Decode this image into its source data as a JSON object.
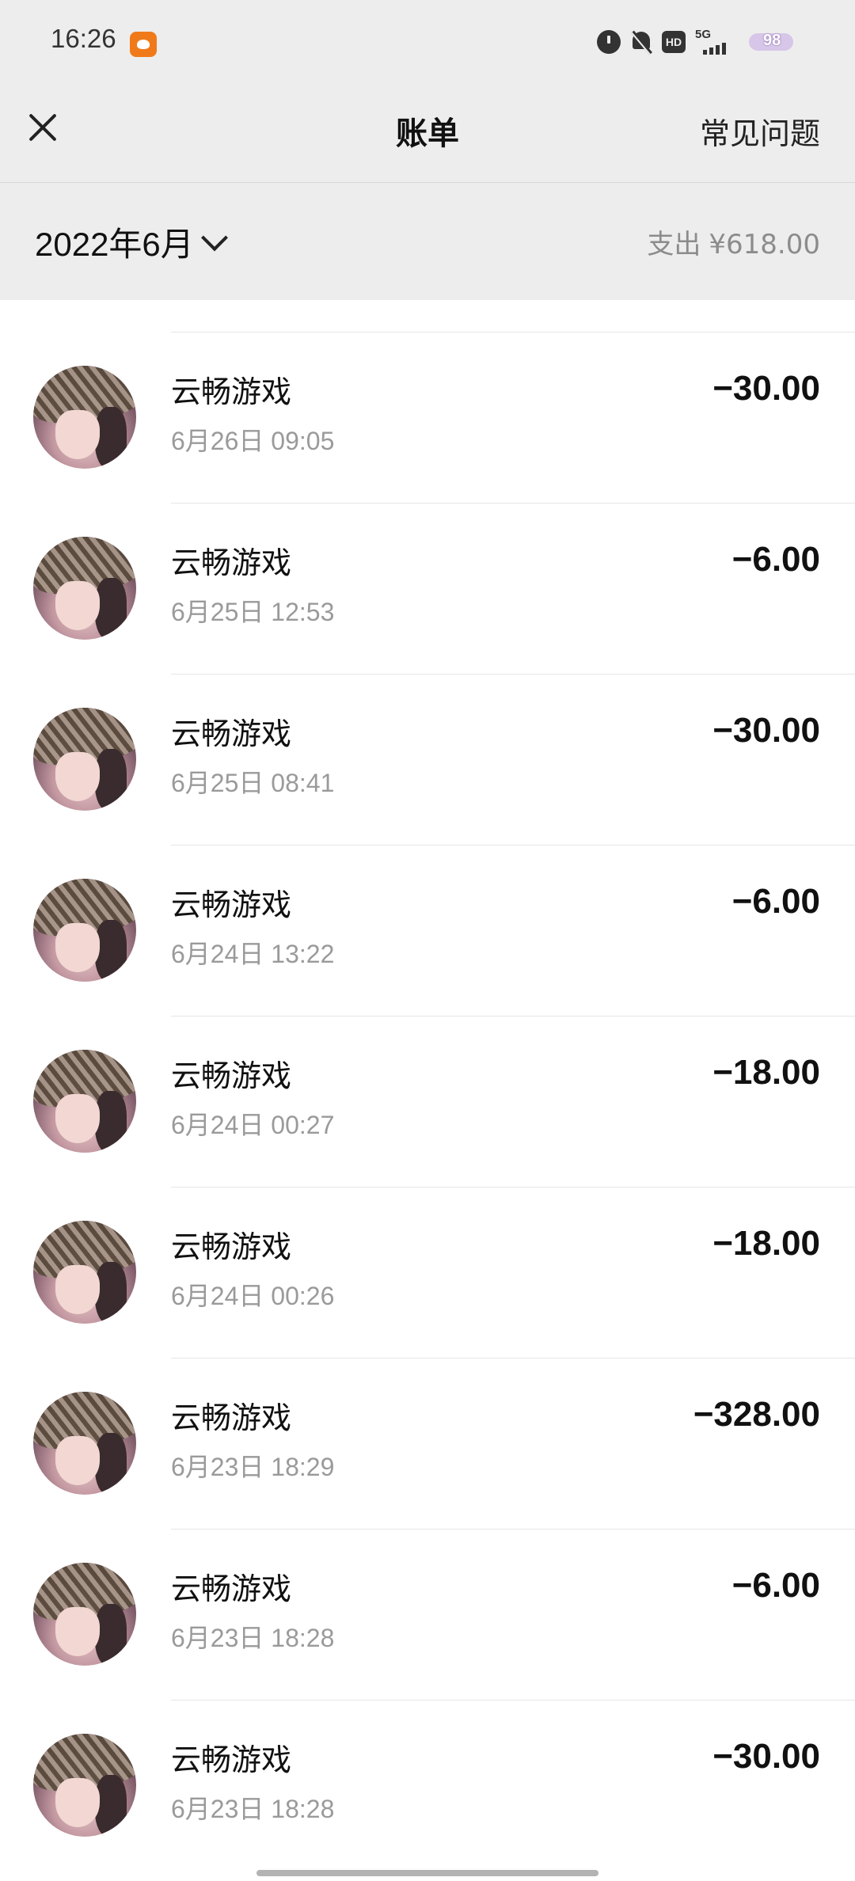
{
  "status_bar": {
    "time": "16:26",
    "hd_label": "HD",
    "network_label": "5G",
    "battery_level": "98"
  },
  "nav": {
    "title": "账单",
    "faq_label": "常见问题"
  },
  "filter": {
    "month_label": "2022年6月",
    "expense_label": "支出",
    "expense_amount": "¥618.00"
  },
  "transactions": [
    {
      "merchant": "云畅游戏",
      "datetime": "6月26日  09:05",
      "amount": "−30.00"
    },
    {
      "merchant": "云畅游戏",
      "datetime": "6月25日  12:53",
      "amount": "−6.00"
    },
    {
      "merchant": "云畅游戏",
      "datetime": "6月25日  08:41",
      "amount": "−30.00"
    },
    {
      "merchant": "云畅游戏",
      "datetime": "6月24日  13:22",
      "amount": "−6.00"
    },
    {
      "merchant": "云畅游戏",
      "datetime": "6月24日  00:27",
      "amount": "−18.00"
    },
    {
      "merchant": "云畅游戏",
      "datetime": "6月24日  00:26",
      "amount": "−18.00"
    },
    {
      "merchant": "云畅游戏",
      "datetime": "6月23日  18:29",
      "amount": "−328.00"
    },
    {
      "merchant": "云畅游戏",
      "datetime": "6月23日  18:28",
      "amount": "−6.00"
    },
    {
      "merchant": "云畅游戏",
      "datetime": "6月23日  18:28",
      "amount": "−30.00"
    }
  ]
}
